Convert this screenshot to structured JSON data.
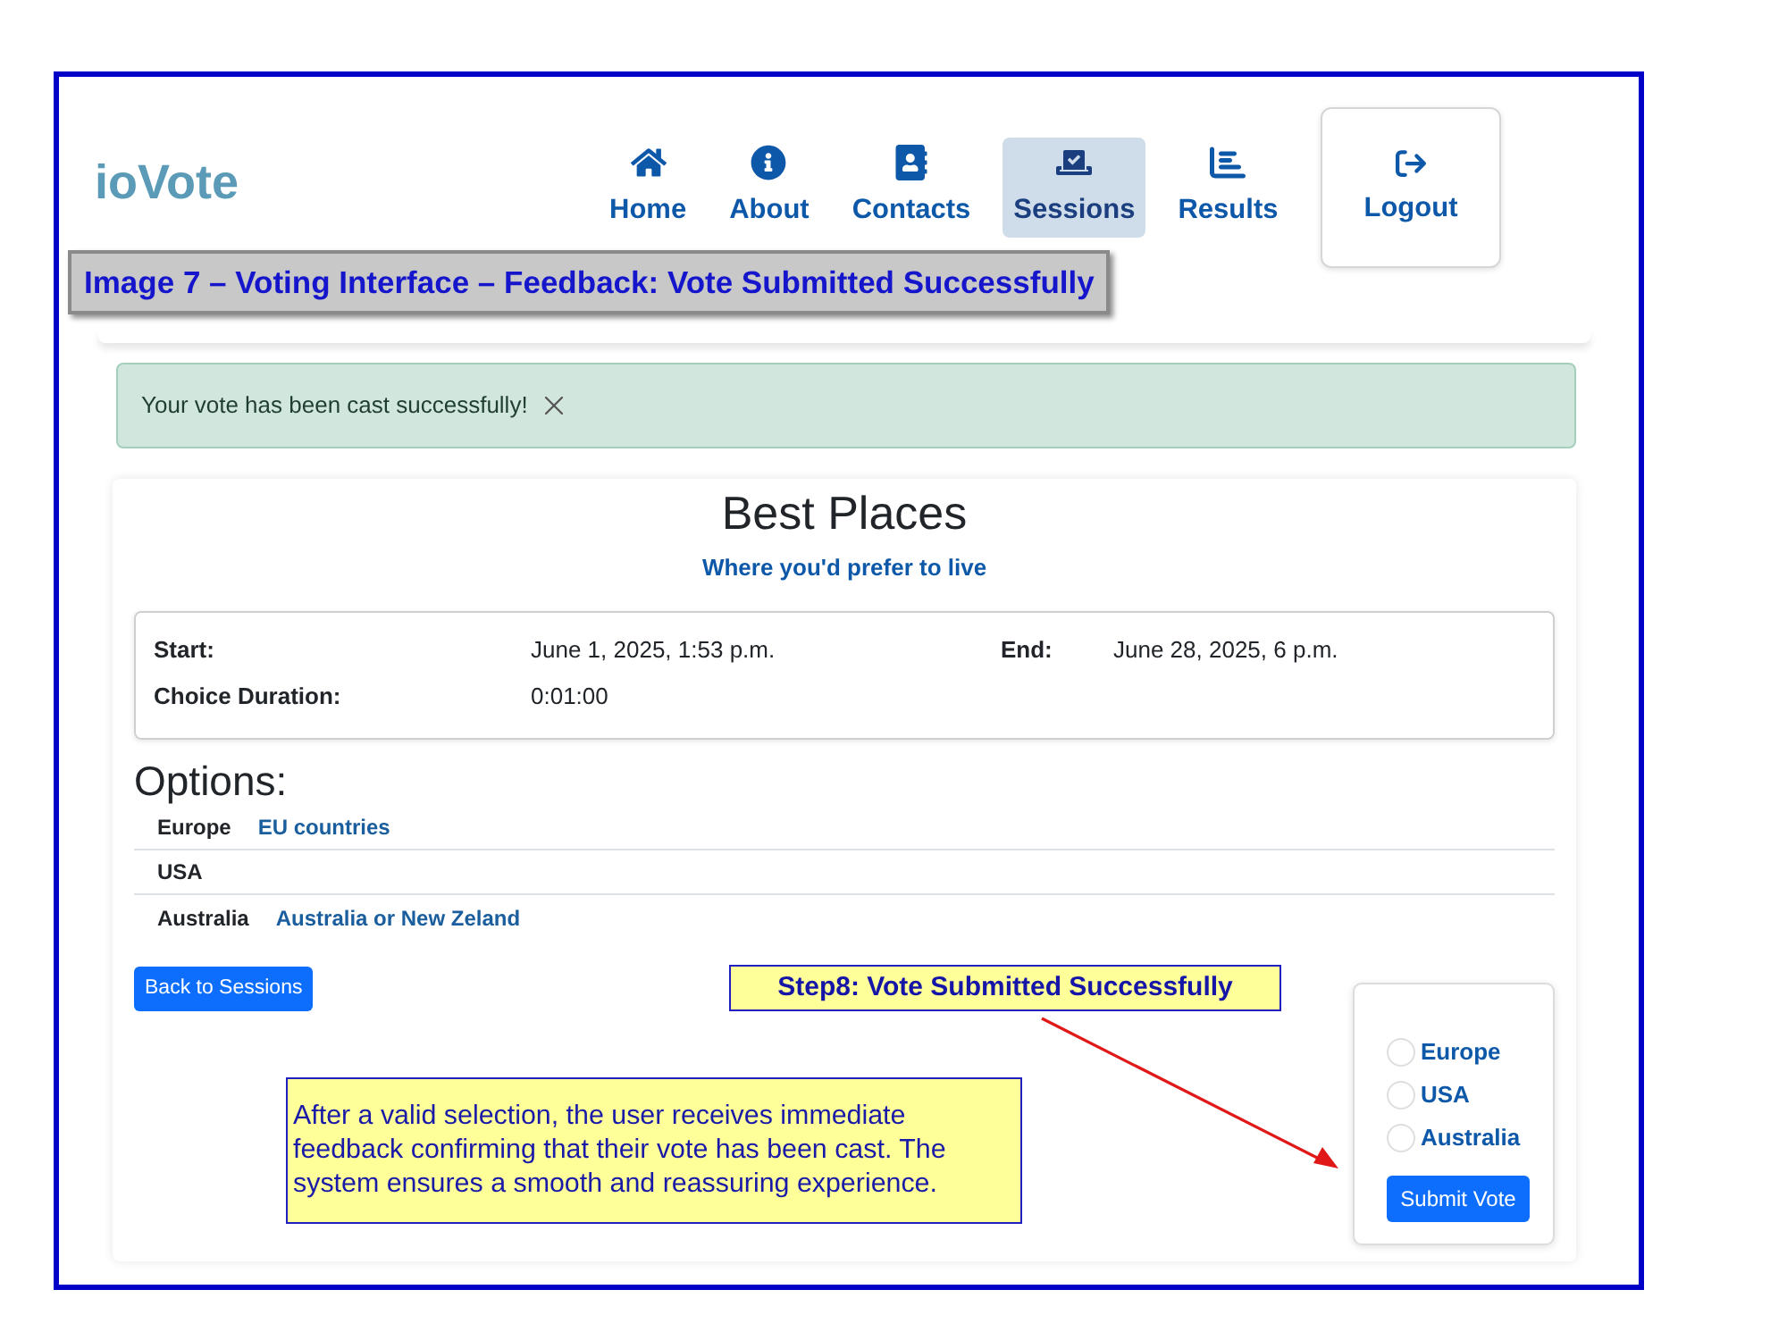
{
  "nav": {
    "logo": "ioVote",
    "items": [
      {
        "label": "Home",
        "selected": false
      },
      {
        "label": "About",
        "selected": false
      },
      {
        "label": "Contacts",
        "selected": false
      },
      {
        "label": "Sessions",
        "selected": true
      },
      {
        "label": "Results",
        "selected": false
      }
    ],
    "logout": "Logout"
  },
  "annotations": {
    "caption": "Image 7 – Voting Interface – Feedback: Vote Submitted Successfully",
    "step": "Step8: Vote Submitted Successfully",
    "note": "After a valid selection, the user receives immediate feedback confirming that their vote has been cast. The system ensures a smooth and reassuring experience."
  },
  "alert": {
    "message": "Your vote has been cast successfully!"
  },
  "session": {
    "title": "Best Places",
    "subtitle": "Where you'd prefer to live",
    "details": [
      {
        "label": "Start:",
        "value": "June 1, 2025, 1:53 p.m."
      },
      {
        "label": "End:",
        "value": "June 28, 2025, 6 p.m."
      },
      {
        "label": "Choice Duration:",
        "value": "0:01:00"
      }
    ],
    "options_heading": "Options:",
    "options": [
      {
        "name": "Europe",
        "description": "EU countries"
      },
      {
        "name": "USA"
      },
      {
        "name": "Australia",
        "description": "Australia or New Zeland"
      }
    ],
    "back_button": "Back to Sessions"
  },
  "vote_form": {
    "choices": [
      {
        "label": "Europe",
        "selected": false
      },
      {
        "label": "USA",
        "selected": false
      },
      {
        "label": "Australia",
        "selected": false
      }
    ],
    "submit": "Submit Vote"
  }
}
